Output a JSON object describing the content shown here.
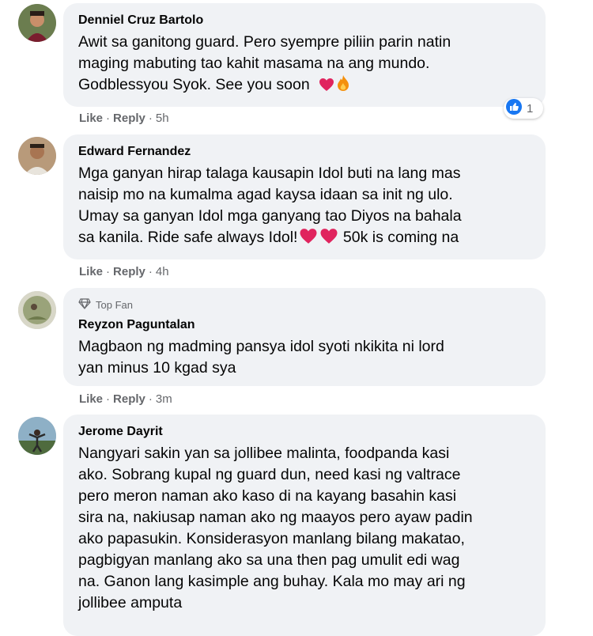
{
  "comments": [
    {
      "author": "Denniel Cruz Bartolo",
      "lines": [
        "Awit sa ganitong guard. Pero syempre piliin parin natin",
        "maging mabuting tao kahit masama na ang mundo.",
        "Godblessyou Syok. See you soon"
      ],
      "emojis": [
        "heart-icon",
        "fire-icon"
      ],
      "reaction_count": "1",
      "like": "Like",
      "reply": "Reply",
      "time": "5h"
    },
    {
      "author": "Edward Fernandez",
      "lines": [
        "Mga ganyan hirap talaga kausapin Idol buti na lang mas",
        "naisip mo na kumalma agad kaysa idaan sa init ng ulo.",
        "Umay sa ganyan Idol mga ganyang tao Diyos na bahala",
        "sa kanila. Ride safe always Idol!"
      ],
      "trailing_text": "50k is coming na",
      "like": "Like",
      "reply": "Reply",
      "time": "4h"
    },
    {
      "badge": "Top Fan",
      "author": "Reyzon Paguntalan",
      "lines": [
        "Magbaon ng madming pansya idol syoti nkikita ni lord",
        "yan minus 10 kgad sya"
      ],
      "like": "Like",
      "reply": "Reply",
      "time": "3m"
    },
    {
      "author": "Jerome Dayrit",
      "lines": [
        "Nangyari sakin yan sa jollibee malinta, foodpanda kasi",
        "ako. Sobrang kupal ng guard dun, need kasi ng valtrace",
        "pero meron naman ako kaso di na kayang basahin kasi",
        "sira na, nakiusap naman ako ng maayos pero ayaw padin",
        "ako papasukin. Konsiderasyon manlang bilang makatao,",
        "pagbigyan manlang ako sa una then pag umulit edi wag",
        "na. Ganon lang kasimple ang buhay. Kala mo may ari ng",
        "jollibee amputa"
      ]
    }
  ],
  "colors": {
    "bubble": "#f0f2f5",
    "meta": "#65676b",
    "like_blue": "#1877f2",
    "heart_red": "#e0245e"
  }
}
